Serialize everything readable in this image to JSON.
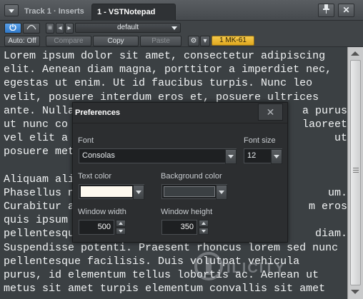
{
  "window": {
    "inactive_tab": "Track 1 · Inserts",
    "active_tab": "1 - VSTNotepad",
    "pin_icon": "pin-icon",
    "close_icon": "close-icon"
  },
  "toolbar": {
    "power_icon": "power-icon",
    "bypass_icon": "bypass-icon",
    "auto_label": "Auto: Off",
    "compare_label": "Compare",
    "copy_label": "Copy",
    "paste_label": "Paste",
    "preset_name": "default",
    "device_badge": "1 MK-61",
    "accent_color": "#3b8ad8",
    "badge_color": "#f0bd3a"
  },
  "editor": {
    "lines": [
      "Lorem ipsum dolor sit amet, consectetur adipiscing",
      "elit. Aenean diam magna, porttitor a imperdiet nec,",
      "egestas ut enim. Ut id faucibus turpis. Nunc leo",
      "velit, posuere interdum eros et, posuere ultrices",
      "ante. Nulla",
      "ut nunc co",
      "vel elit a",
      "posuere met",
      "",
      "Aliquam ali",
      "Phasellus n",
      "Curabitur a",
      "quis ipsum",
      "pellentesque",
      "Suspendisse potenti. Praesent rhoncus lorem sed nunc",
      "pellentesque facilisis. Duis volutpat vehicula",
      "purus, id elementum tellus lobortis ac. Aenean ut",
      "metus sit amet turpis elementum convallis sit amet"
    ],
    "right_fragments": [
      {
        "line": 4,
        "text": "a purus"
      },
      {
        "line": 5,
        "text": "laoreet"
      },
      {
        "line": 6,
        "text": "ut"
      },
      {
        "line": 10,
        "text": "um."
      },
      {
        "line": 11,
        "text": "m eros"
      },
      {
        "line": 13,
        "text": "diam."
      }
    ],
    "background": "#3b4043",
    "text_color": "#f2f4f5"
  },
  "preferences": {
    "title": "Preferences",
    "font_label": "Font",
    "font_value": "Consolas",
    "font_size_label": "Font size",
    "font_size_value": "12",
    "text_color_label": "Text color",
    "text_color_value": "#fffaf0",
    "background_color_label": "Background color",
    "background_color_value": "#3b4043",
    "window_width_label": "Window width",
    "window_width_value": "500",
    "window_height_label": "Window height",
    "window_height_value": "350"
  },
  "watermark": {
    "text": "ILICITY"
  }
}
